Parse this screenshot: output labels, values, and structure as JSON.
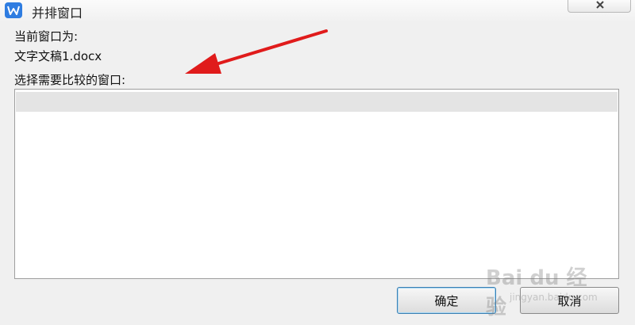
{
  "window": {
    "title": "并排窗口",
    "app_icon": "wps-writer-icon"
  },
  "dialog": {
    "current_window_label": "当前窗口为:",
    "current_document": "文字文稿1.docx",
    "select_label": "选择需要比较的窗口:",
    "window_list": [
      ""
    ]
  },
  "buttons": {
    "ok_label": "确定",
    "cancel_label": "取消"
  },
  "colors": {
    "annotation_arrow": "#e01b1b",
    "accent": "#2f7de1"
  },
  "watermark": {
    "logo_text": "Bai du 经验",
    "sub_text": "jingyan.baidu.com"
  }
}
